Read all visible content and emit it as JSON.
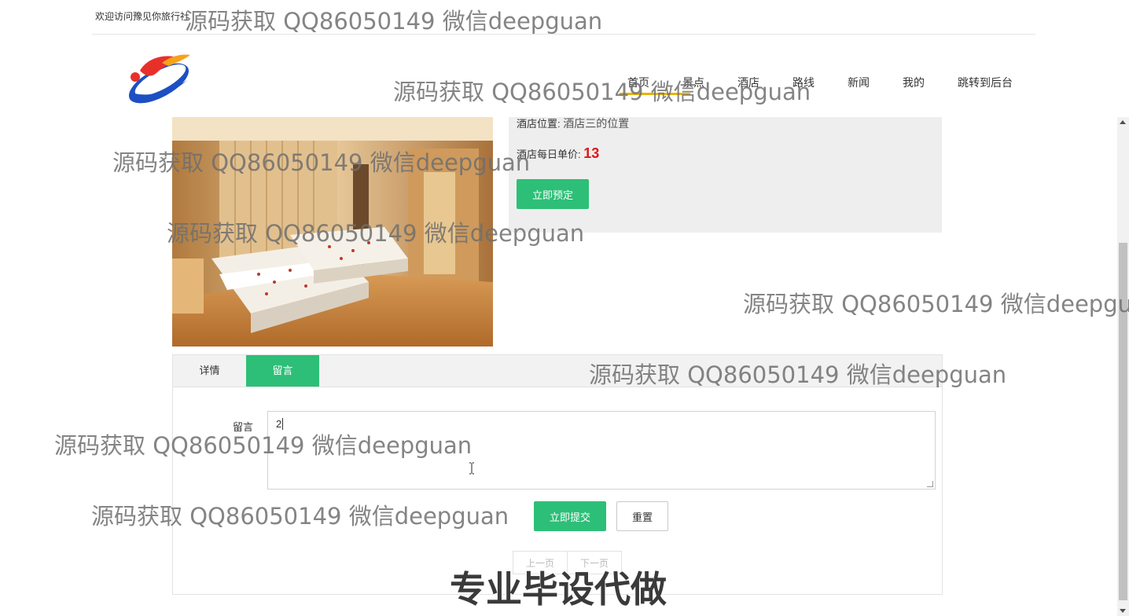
{
  "header": {
    "welcome": "欢迎访问豫见你旅行社"
  },
  "nav": {
    "items": [
      {
        "label": "首页",
        "active": true
      },
      {
        "label": "景点",
        "active": false
      },
      {
        "label": "酒店",
        "active": false
      },
      {
        "label": "路线",
        "active": false
      },
      {
        "label": "新闻",
        "active": false
      },
      {
        "label": "我的",
        "active": false
      },
      {
        "label": "跳转到后台",
        "active": false
      }
    ]
  },
  "hotel": {
    "location_label": "酒店位置:",
    "location_value": "酒店三的位置",
    "price_label": "酒店每日单价:",
    "price_value": "13",
    "book_button": "立即预定"
  },
  "tabs": {
    "items": [
      {
        "label": "详情",
        "active": false
      },
      {
        "label": "留言",
        "active": true
      }
    ]
  },
  "comment_form": {
    "label": "留言",
    "value": "2",
    "submit_button": "立即提交",
    "reset_button": "重置"
  },
  "pager": {
    "prev": "上一页",
    "next": "下一页"
  },
  "watermarks": {
    "text": "源码获取 QQ86050149 微信deepguan",
    "text_cut": "源码获取 QQ86050149 微信deepgu",
    "bottom": "专业毕设代做"
  },
  "colors": {
    "accent_green": "#2dbf77",
    "price_red": "#e01515",
    "nav_active_underline": "#e8b400"
  }
}
